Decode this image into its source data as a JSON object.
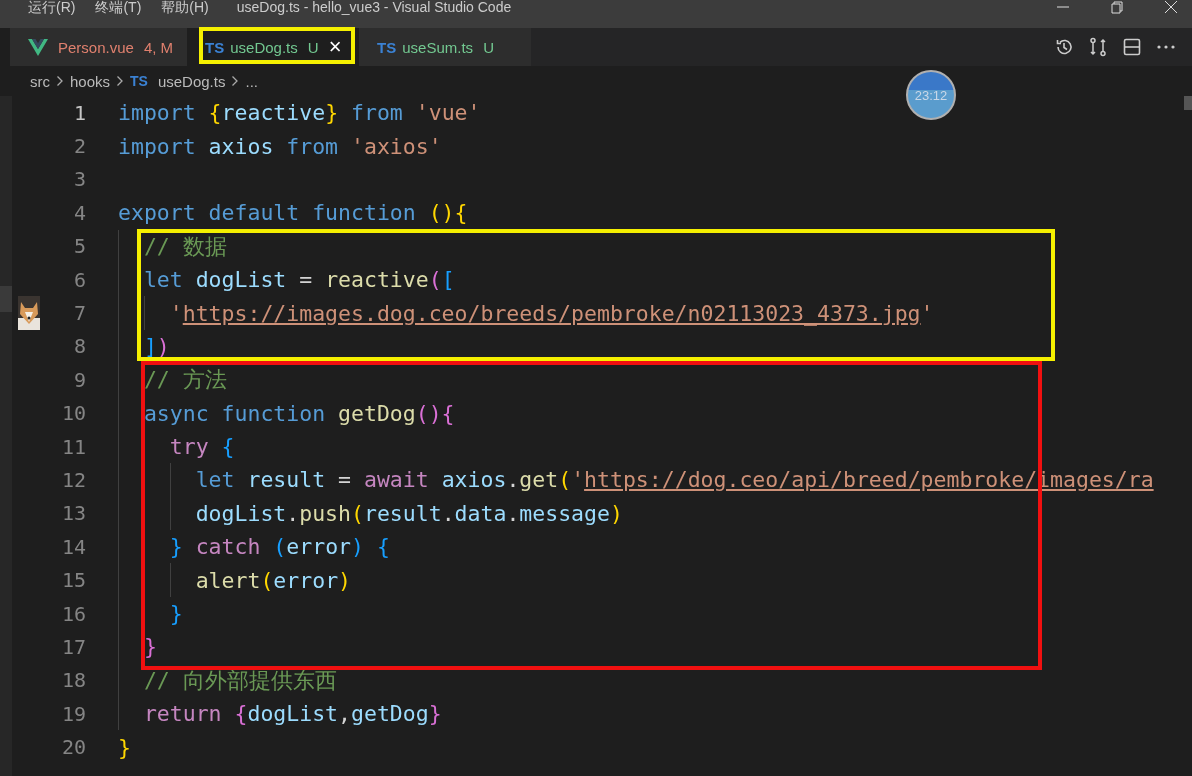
{
  "window": {
    "menu": [
      "运行(R)",
      "终端(T)",
      "帮助(H)"
    ],
    "title": "useDog.ts - hello_vue3 - Visual Studio Code"
  },
  "tabs": [
    {
      "kind": "vue",
      "name": "Person.vue",
      "status": "4, M",
      "color": "#e0806e",
      "selected": false
    },
    {
      "kind": "ts",
      "badge": "TS",
      "name": "useDog.ts",
      "status": "U",
      "color": "#73c991",
      "selected": true,
      "close": "×"
    },
    {
      "kind": "ts",
      "badge": "TS",
      "name": "useSum.ts",
      "status": "U",
      "color": "#73c991",
      "selected": false
    }
  ],
  "breadcrumb": [
    {
      "text": "src"
    },
    {
      "text": "hooks"
    },
    {
      "badge": "TS",
      "text": "useDog.ts"
    },
    {
      "text": "..."
    }
  ],
  "clock": "23:12",
  "lines": [
    {
      "number": "1",
      "active": true,
      "tokens": [
        {
          "kind": "kw",
          "text": "import "
        },
        {
          "kind": "b1",
          "text": "{"
        },
        {
          "kind": "var",
          "text": "reactive"
        },
        {
          "kind": "b1",
          "text": "}"
        },
        {
          "kind": "kw",
          "text": " from "
        },
        {
          "kind": "str",
          "text": "'vue'"
        }
      ]
    },
    {
      "number": "2",
      "active": false,
      "tokens": [
        {
          "kind": "kw",
          "text": "import "
        },
        {
          "kind": "var",
          "text": "axios"
        },
        {
          "kind": "kw",
          "text": " from "
        },
        {
          "kind": "str",
          "text": "'axios'"
        }
      ]
    },
    {
      "number": "3",
      "active": false
    },
    {
      "number": "4",
      "active": false,
      "tokens": [
        {
          "kind": "kw",
          "text": "export default function "
        },
        {
          "kind": "b1",
          "text": "(){"
        }
      ]
    },
    {
      "number": "5",
      "active": false,
      "tokens": [
        {
          "kind": "cm",
          "text": "  // 数据"
        }
      ]
    },
    {
      "number": "6",
      "active": false,
      "tokens": [
        {
          "kind": "kw",
          "text": "  let "
        },
        {
          "kind": "var",
          "text": "dogList"
        },
        {
          "kind": "pun",
          "text": " = "
        },
        {
          "kind": "fn",
          "text": "reactive"
        },
        {
          "kind": "b2",
          "text": "("
        },
        {
          "kind": "b3",
          "text": "["
        }
      ]
    },
    {
      "number": "7",
      "active": false,
      "gutter": {
        "kind": "picture"
      },
      "tokens": [
        {
          "kind": "str",
          "text": "    '"
        },
        {
          "kind": "link",
          "text": "https://images.dog.ceo/breeds/pembroke/n02113023_4373.jpg"
        },
        {
          "kind": "str",
          "text": "'"
        }
      ]
    },
    {
      "number": "8",
      "active": false,
      "tokens": [
        {
          "kind": "b3",
          "text": "  ]"
        },
        {
          "kind": "b2",
          "text": ")"
        }
      ]
    },
    {
      "number": "9",
      "active": false,
      "tokens": [
        {
          "kind": "cm",
          "text": "  // 方法"
        }
      ]
    },
    {
      "number": "10",
      "active": false,
      "tokens": [
        {
          "kind": "kw",
          "text": "  async function "
        },
        {
          "kind": "fn",
          "text": "getDog"
        },
        {
          "kind": "b2",
          "text": "(){"
        }
      ]
    },
    {
      "number": "11",
      "active": false,
      "tokens": [
        {
          "kind": "ctrl",
          "text": "    try "
        },
        {
          "kind": "b3",
          "text": "{"
        }
      ]
    },
    {
      "number": "12",
      "active": false,
      "tokens": [
        {
          "kind": "kw",
          "text": "      let "
        },
        {
          "kind": "var",
          "text": "result"
        },
        {
          "kind": "pun",
          "text": " = "
        },
        {
          "kind": "ctrl",
          "text": "await "
        },
        {
          "kind": "var",
          "text": "axios"
        },
        {
          "kind": "pun",
          "text": "."
        },
        {
          "kind": "fn",
          "text": "get"
        },
        {
          "kind": "b1",
          "text": "("
        },
        {
          "kind": "str",
          "text": "'"
        },
        {
          "kind": "link",
          "text": "https://dog.ceo/api/breed/pembroke/images/ra"
        }
      ]
    },
    {
      "number": "13",
      "active": false,
      "tokens": [
        {
          "kind": "var",
          "text": "      dogList"
        },
        {
          "kind": "pun",
          "text": "."
        },
        {
          "kind": "fn",
          "text": "push"
        },
        {
          "kind": "b1",
          "text": "("
        },
        {
          "kind": "var",
          "text": "result"
        },
        {
          "kind": "pun",
          "text": "."
        },
        {
          "kind": "var",
          "text": "data"
        },
        {
          "kind": "pun",
          "text": "."
        },
        {
          "kind": "var",
          "text": "message"
        },
        {
          "kind": "b1",
          "text": ")"
        }
      ]
    },
    {
      "number": "14",
      "active": false,
      "tokens": [
        {
          "kind": "b3",
          "text": "    }"
        },
        {
          "kind": "ctrl",
          "text": " catch "
        },
        {
          "kind": "b3",
          "text": "("
        },
        {
          "kind": "var",
          "text": "error"
        },
        {
          "kind": "b3",
          "text": ") {"
        }
      ]
    },
    {
      "number": "15",
      "active": false,
      "tokens": [
        {
          "kind": "fn",
          "text": "      alert"
        },
        {
          "kind": "b1",
          "text": "("
        },
        {
          "kind": "var",
          "text": "error"
        },
        {
          "kind": "b1",
          "text": ")"
        }
      ]
    },
    {
      "number": "16",
      "active": false,
      "tokens": [
        {
          "kind": "b3",
          "text": "    }"
        }
      ]
    },
    {
      "number": "17",
      "active": false,
      "tokens": [
        {
          "kind": "b2",
          "text": "  }"
        }
      ]
    },
    {
      "number": "18",
      "active": false,
      "tokens": [
        {
          "kind": "cm",
          "text": "  // 向外部提供东西"
        }
      ]
    },
    {
      "number": "19",
      "active": false,
      "tokens": [
        {
          "kind": "ctrl",
          "text": "  return "
        },
        {
          "kind": "b2",
          "text": "{"
        },
        {
          "kind": "var",
          "text": "dogList"
        },
        {
          "kind": "pun",
          "text": ","
        },
        {
          "kind": "var",
          "text": "getDog"
        },
        {
          "kind": "b2",
          "text": "}"
        }
      ]
    },
    {
      "number": "20",
      "active": false,
      "tokens": [
        {
          "kind": "b1",
          "text": "}"
        }
      ]
    }
  ]
}
